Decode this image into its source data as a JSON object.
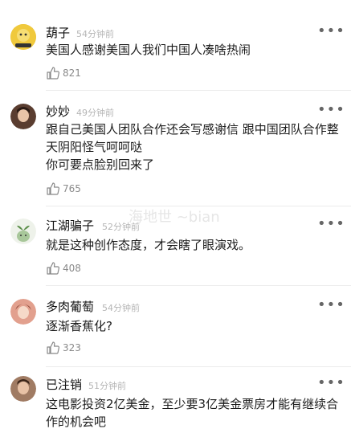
{
  "comments": [
    {
      "name": "葫子",
      "time": "54分钟前",
      "text": "美国人感谢美国人我们中国人凑啥热闹",
      "likes": "821",
      "avatar_color": "#e8c34a",
      "avatar_icon": "yellow-cartoon-avatar"
    },
    {
      "name": "妙妙",
      "time": "49分钟前",
      "text": "跟自己美国人团队合作还会写感谢信 跟中国团队合作整天阴阳怪气呵呵哒\n你可要点脸别回来了",
      "likes": "765",
      "avatar_color": "#6b4a3a",
      "avatar_icon": "photo-avatar"
    },
    {
      "name": "江湖骗子",
      "time": "52分钟前",
      "text": "就是这种创作态度，才会瞎了眼演戏。",
      "likes": "408",
      "avatar_color": "#dfe8d6",
      "avatar_icon": "plant-cartoon-avatar"
    },
    {
      "name": "多肉葡萄",
      "time": "54分钟前",
      "text": "逐渐香蕉化?",
      "likes": "323",
      "avatar_color": "#d98c7a",
      "avatar_icon": "girl-photo-avatar"
    },
    {
      "name": "已注销",
      "time": "51分钟前",
      "text": "这电影投资2亿美金，至少要3亿美金票房才能有继续合作的机会吧",
      "likes": "",
      "avatar_color": "#b08870",
      "avatar_icon": "photo-avatar"
    }
  ],
  "more_label": "•••",
  "watermark": "海地世 ~bian"
}
